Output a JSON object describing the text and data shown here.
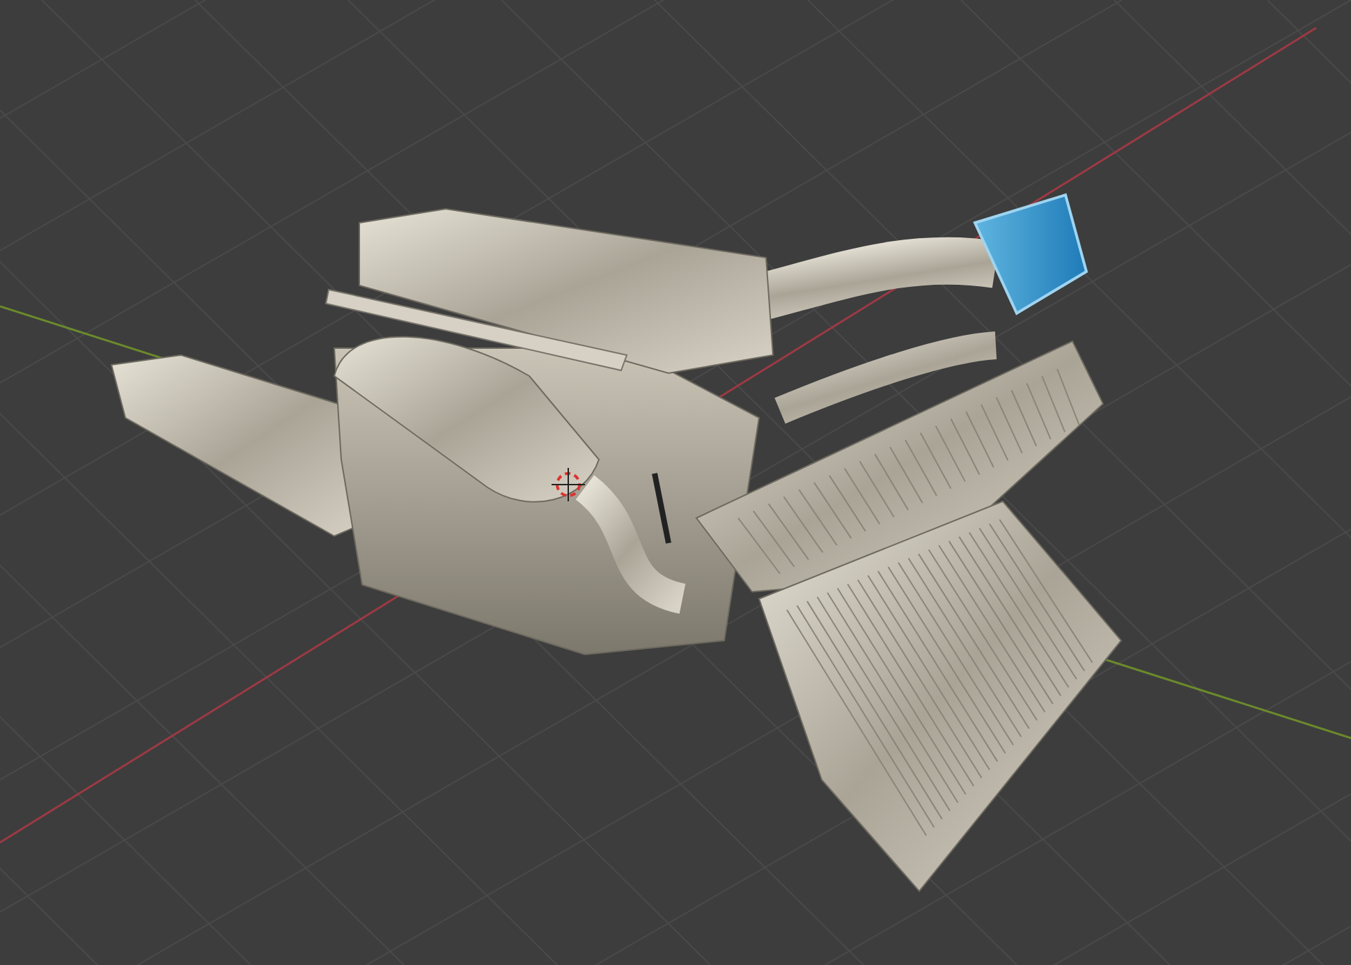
{
  "viewport": {
    "grid_visible": true,
    "axes_visible": true,
    "cursor_visible": true
  }
}
